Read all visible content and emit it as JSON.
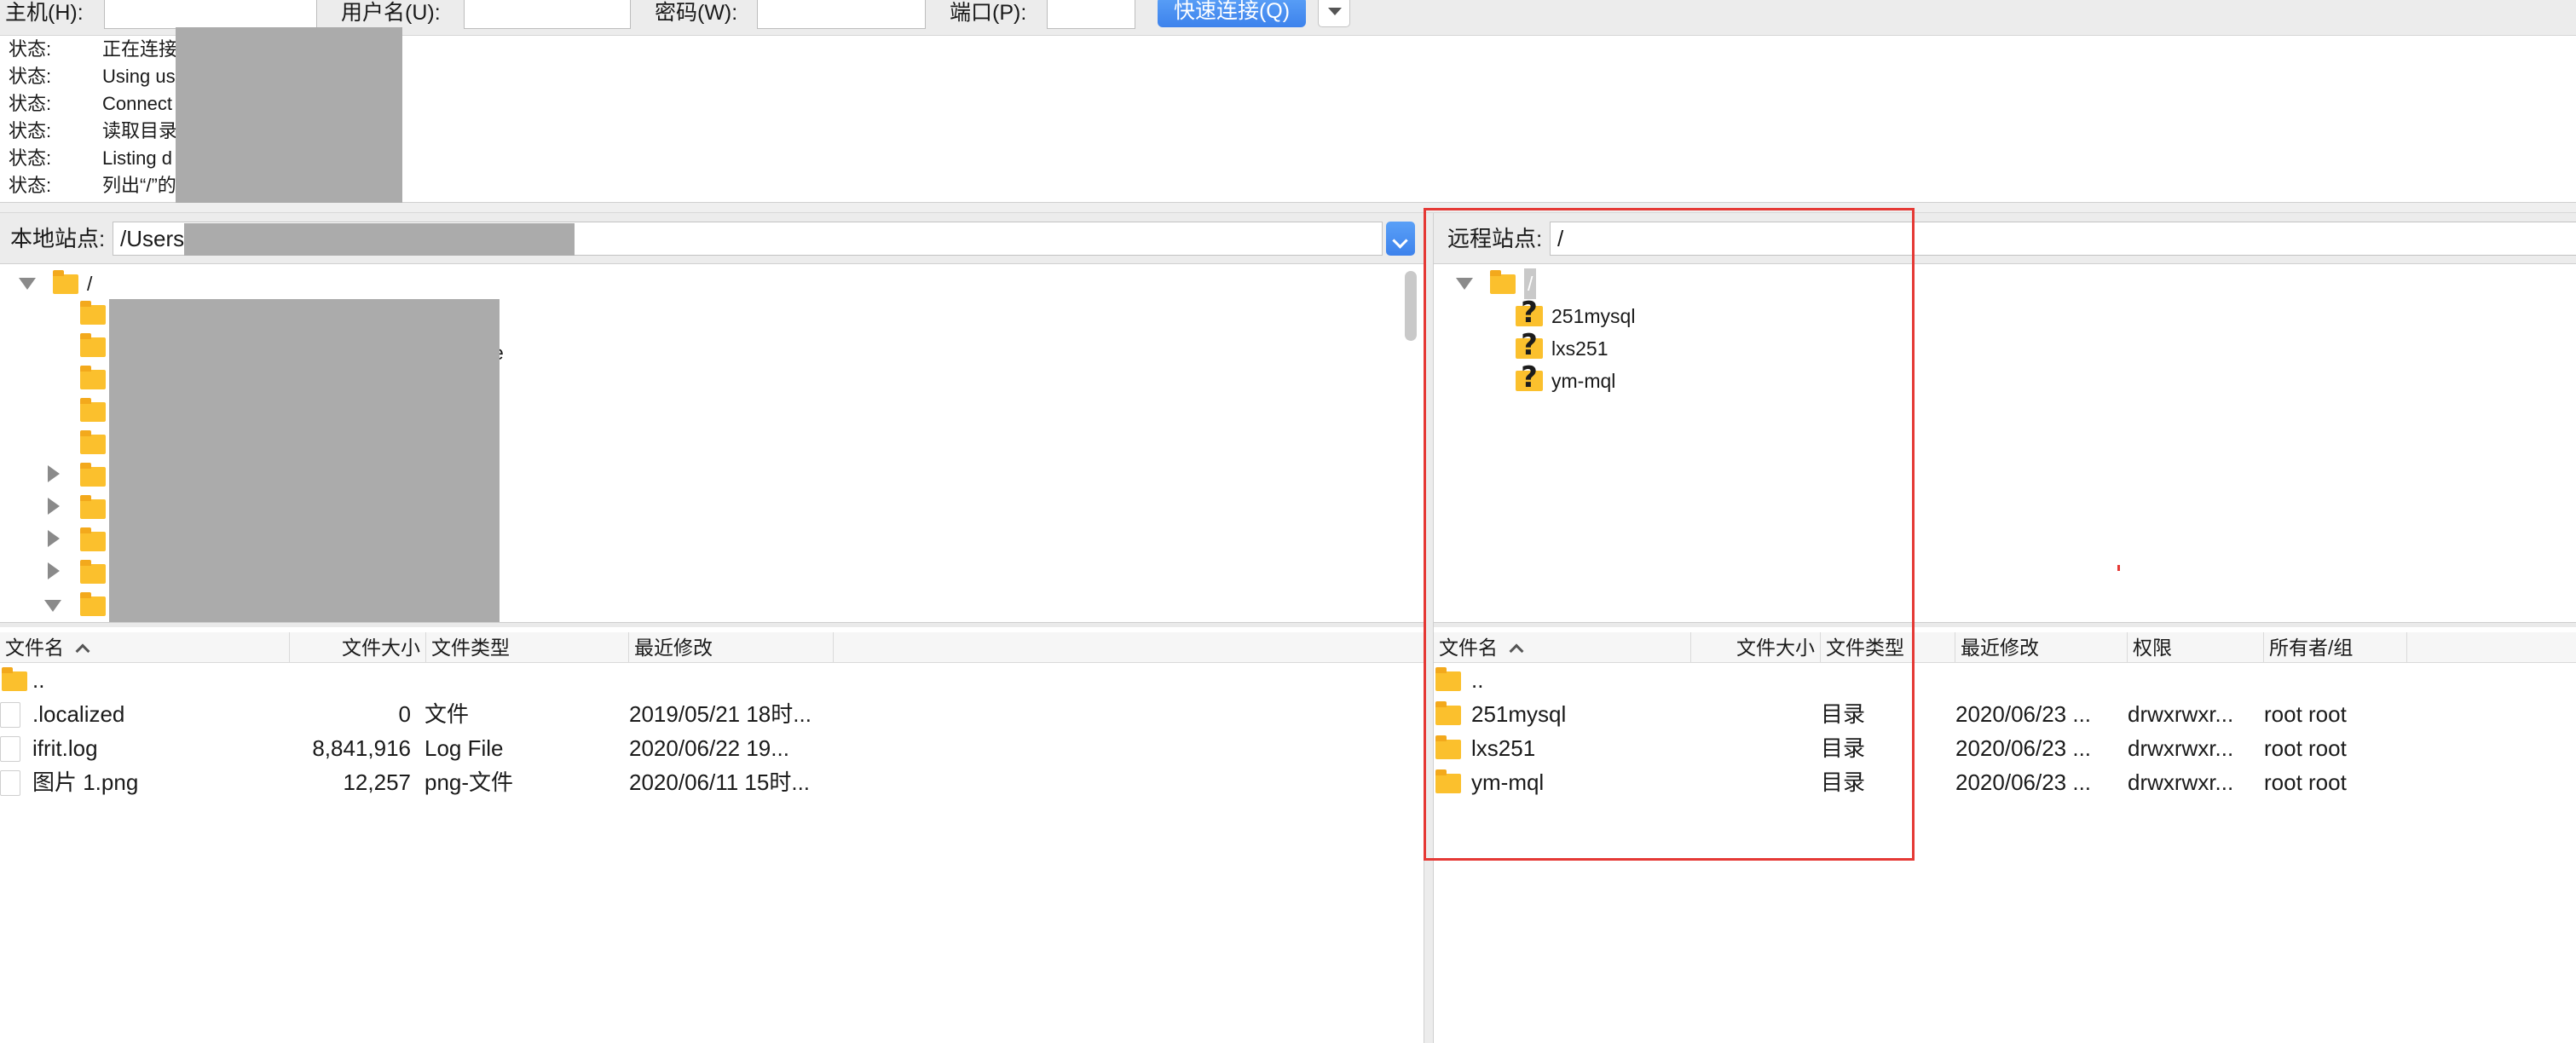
{
  "quickconnect": {
    "host_label": "主机(H):",
    "username_label": "用户名(U):",
    "password_label": "密码(W):",
    "port_label": "端口(P):",
    "host_value": "",
    "username_value": "",
    "password_value": "",
    "port_value": "",
    "connect_button": "快速连接(Q)"
  },
  "message_log": [
    {
      "status": "状态:",
      "message": "正在连接"
    },
    {
      "status": "状态:",
      "message": "Using us"
    },
    {
      "status": "状态:",
      "message": "Connect"
    },
    {
      "status": "状态:",
      "message": "读取目录"
    },
    {
      "status": "状态:",
      "message": "Listing d"
    },
    {
      "status": "状态:",
      "message": "列出“/”的"
    }
  ],
  "local": {
    "site_label": "本地站点:",
    "path_value": "/Users",
    "tree_root": "/",
    "tree_partial_text": "e",
    "columns": [
      "文件名",
      "文件大小",
      "文件类型",
      "最近修改"
    ],
    "files": [
      {
        "name": "..",
        "size": "",
        "type": "",
        "modified": ""
      },
      {
        "name": ".localized",
        "size": "0",
        "type": "文件",
        "modified": "2019/05/21 18时..."
      },
      {
        "name": "ifrit.log",
        "size": "8,841,916",
        "type": "Log File",
        "modified": "2020/06/22 19..."
      },
      {
        "name": "图片 1.png",
        "size": "12,257",
        "type": "png-文件",
        "modified": "2020/06/11 15时..."
      }
    ]
  },
  "remote": {
    "site_label": "远程站点:",
    "path_value": "/",
    "tree_root": "/",
    "tree_items": [
      "251mysql",
      "lxs251",
      "ym-mql"
    ],
    "columns": [
      "文件名",
      "文件大小",
      "文件类型",
      "最近修改",
      "权限",
      "所有者/组"
    ],
    "files": [
      {
        "name": "..",
        "size": "",
        "type": "",
        "modified": "",
        "perms": "",
        "owner": ""
      },
      {
        "name": "251mysql",
        "size": "",
        "type": "目录",
        "modified": "2020/06/23 ...",
        "perms": "drwxrwxr...",
        "owner": "root root"
      },
      {
        "name": "lxs251",
        "size": "",
        "type": "目录",
        "modified": "2020/06/23 ...",
        "perms": "drwxrwxr...",
        "owner": "root root"
      },
      {
        "name": "ym-mql",
        "size": "",
        "type": "目录",
        "modified": "2020/06/23 ...",
        "perms": "drwxrwxr...",
        "owner": "root root"
      }
    ]
  },
  "colors": {
    "accent": "#3d82ec",
    "folder": "#fbc02d",
    "highlight": "#e53935",
    "redaction": "#ababab"
  }
}
